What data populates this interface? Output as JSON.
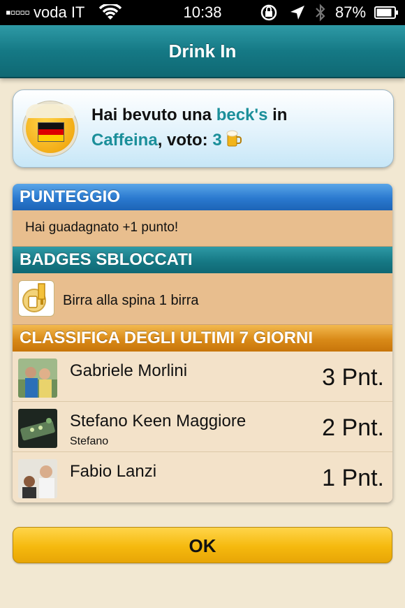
{
  "status_bar": {
    "signal": "▪▫▫▫▫",
    "carrier": "voda IT",
    "time": "10:38",
    "battery": "87%",
    "icons": [
      "wifi-icon",
      "rotation-lock-icon",
      "location-arrow-icon",
      "bluetooth-icon",
      "battery-icon"
    ]
  },
  "nav": {
    "title": "Drink In"
  },
  "checkin": {
    "prefix": "Hai bevuto una",
    "beer": "beck's",
    "in": "in",
    "venue": "Caffeina",
    "vote_label": ", voto:",
    "vote": "3",
    "icons": [
      "beer-badge-icon",
      "germany-flag-icon",
      "beer-mug-icon"
    ]
  },
  "sections": {
    "points_header": "PUNTEGGIO",
    "points_text": "Hai guadagnato +1 punto!",
    "badges_header": "BADGES SBLOCCATI",
    "badge_text": "Birra alla spina 1 birra",
    "ranking_header": "CLASSIFICA DEGLI ULTIMI 7 GIORNI"
  },
  "ranking": [
    {
      "name": "Gabriele Morlini",
      "sub": "",
      "points": "3 Pnt."
    },
    {
      "name": "Stefano Keen Maggiore",
      "sub": "Stefano",
      "points": "2 Pnt."
    },
    {
      "name": "Fabio Lanzi",
      "sub": "",
      "points": "1 Pnt."
    }
  ],
  "ok_label": "OK",
  "colors": {
    "teal": "#1b8f9a",
    "blue_header": "#2a79cf",
    "orange_header": "#d98a18",
    "ok_button": "#f5b90e"
  }
}
